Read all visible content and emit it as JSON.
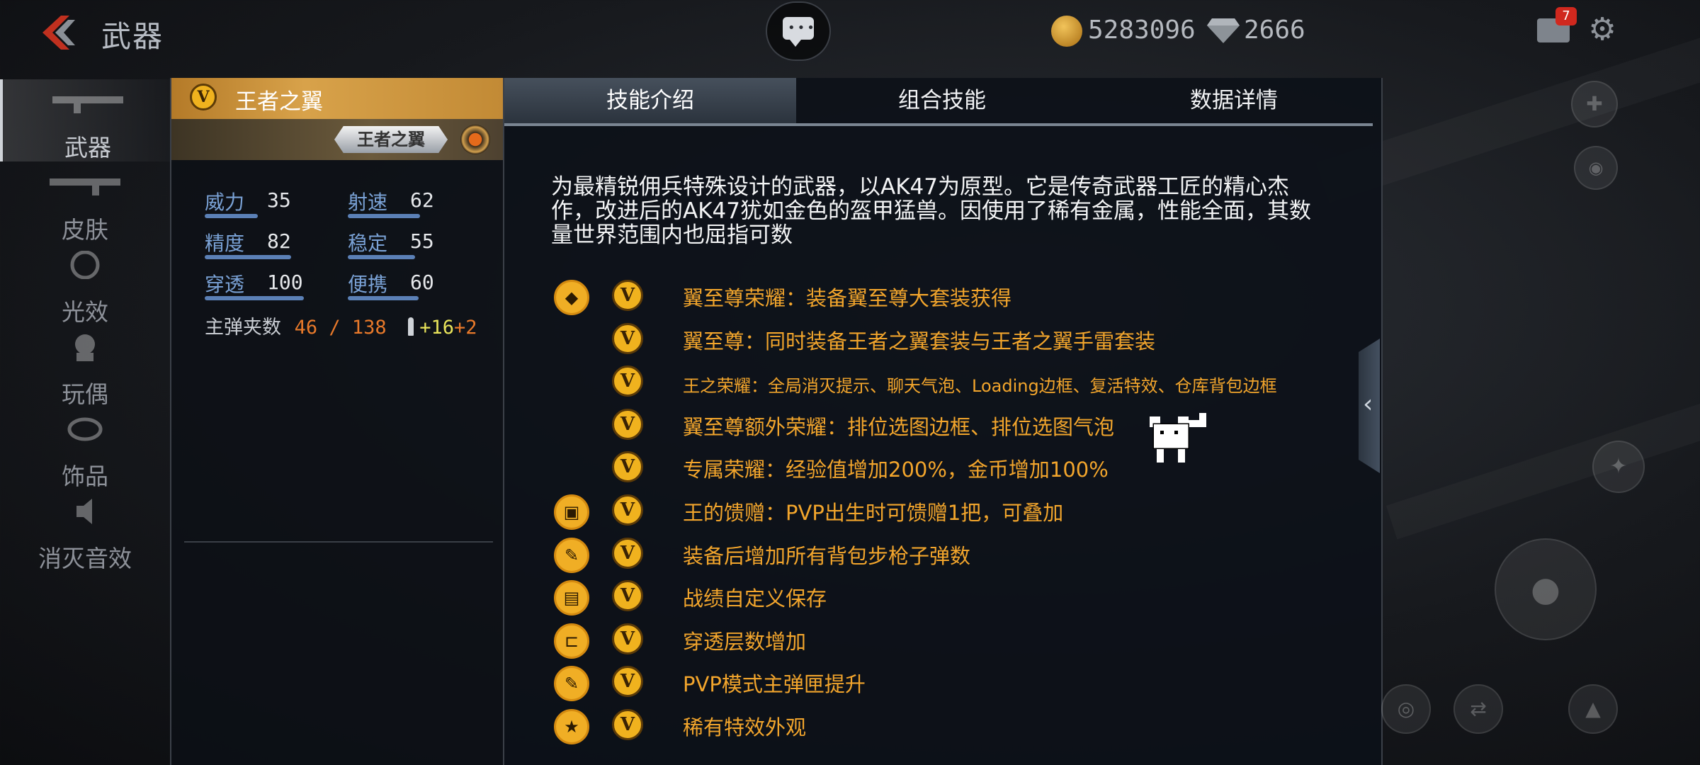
{
  "header": {
    "title": "武器",
    "coins": "5283096",
    "gems": "2666",
    "mail_badge": "7"
  },
  "nav": {
    "items": [
      {
        "label": "武器",
        "icon": "rifle-icon",
        "active": true
      },
      {
        "label": "皮肤",
        "icon": "rifle-skin-icon",
        "active": false
      },
      {
        "label": "光效",
        "icon": "glow-icon",
        "active": false
      },
      {
        "label": "玩偶",
        "icon": "doll-icon",
        "active": false
      },
      {
        "label": "饰品",
        "icon": "ornament-icon",
        "active": false
      },
      {
        "label": "消灭音效",
        "icon": "speaker-icon",
        "active": false
      }
    ]
  },
  "weapon": {
    "name": "王者之翼",
    "logo_text": "王者之翼",
    "badge": "V",
    "stats": [
      {
        "label": "威力",
        "value": "35",
        "level": 0.35
      },
      {
        "label": "射速",
        "value": "62",
        "level": 0.62
      },
      {
        "label": "精度",
        "value": "82",
        "level": 0.82
      },
      {
        "label": "稳定",
        "value": "55",
        "level": 0.55
      },
      {
        "label": "穿透",
        "value": "100",
        "level": 1.0
      },
      {
        "label": "便携",
        "value": "60",
        "level": 0.6
      }
    ],
    "ammo": {
      "label": "主弹夹数",
      "current": "46",
      "total": "138",
      "bonus1": "+16",
      "bonus2": "+2"
    }
  },
  "tabs": [
    {
      "label": "技能介绍",
      "active": true
    },
    {
      "label": "组合技能",
      "active": false
    },
    {
      "label": "数据详情",
      "active": false
    }
  ],
  "description": "为最精锐佣兵特殊设计的武器，以AK47为原型。它是传奇武器工匠的精心杰作，改进后的AK47犹如金色的盔甲猛兽。因使用了稀有金属，性能全面，其数量世界范围内也屈指可数",
  "skills": [
    {
      "icon": "diamond-icon",
      "text": "翼至尊荣耀：装备翼至尊大套装获得",
      "small": false
    },
    {
      "icon": "",
      "text": "翼至尊：同时装备王者之翼套装与王者之翼手雷套装",
      "small": false
    },
    {
      "icon": "",
      "text": "王之荣耀：全局消灭提示、聊天气泡、Loading边框、复活特效、仓库背包边框",
      "small": true
    },
    {
      "icon": "",
      "text": "翼至尊额外荣耀：排位选图边框、排位选图气泡",
      "small": false
    },
    {
      "icon": "",
      "text": "专属荣耀：经验值增加200%，金币增加100%",
      "small": false
    },
    {
      "icon": "gift-icon",
      "text": "王的馈赠：PVP出生时可馈赠1把，可叠加",
      "small": false
    },
    {
      "icon": "rifle-ammo-icon",
      "text": "装备后增加所有背包步枪子弹数",
      "small": false
    },
    {
      "icon": "record-save-icon",
      "text": "战绩自定义保存",
      "small": false
    },
    {
      "icon": "penetration-icon",
      "text": "穿透层数增加",
      "small": false
    },
    {
      "icon": "magazine-icon",
      "text": "PVP模式主弹匣提升",
      "small": false
    },
    {
      "icon": "star-icon",
      "text": "稀有特效外观",
      "small": false
    }
  ],
  "colors": {
    "accent_gold": "#f2a52c",
    "stat_label": "#7aa2d6",
    "ammo_orange": "#e8792a",
    "ammo_yellow": "#e8e35a"
  }
}
